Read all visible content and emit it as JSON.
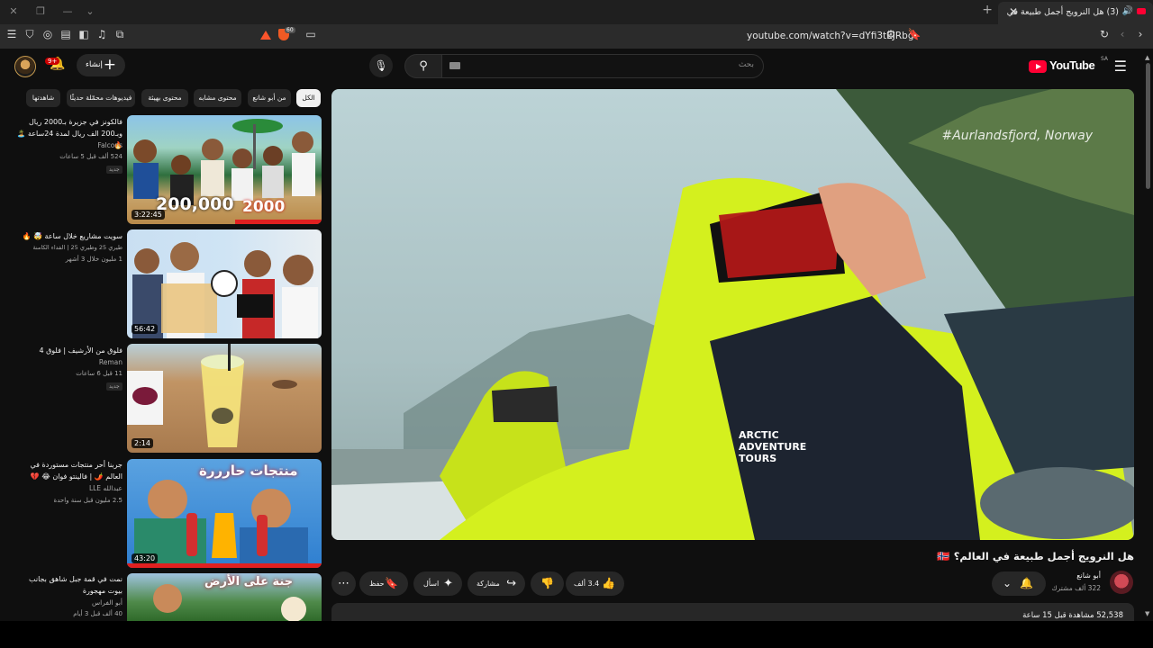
{
  "browser": {
    "tab_title": "(3) هل النرويج أجمل طبيعة في",
    "url": "youtube.com/watch?v=dYfi3tEJRbg",
    "shield_count": "60"
  },
  "header": {
    "logo_text": "YouTube",
    "logo_region": "SA",
    "search_placeholder": "بحث",
    "create_label": "إنشاء",
    "notifications": "9+"
  },
  "chips": [
    "الكل",
    "من أبو شانع",
    "محتوى مشابه",
    "محتوى بهيئة",
    "فيديوهات محمّلة حديثًا",
    "شاهدتها"
  ],
  "related": [
    {
      "title": "فالكونز في جزيرة بـ2000 ريال وبـ200 الف ريال لمدة 24ساعة 🏝️ 🔥",
      "channel": "Falcons",
      "meta": "524 ألف  قبل 5 ساعات",
      "badge": "جديد",
      "duration": "3:22:45",
      "overlay_left": "200,000",
      "overlay_right": "2000"
    },
    {
      "title": "سويت مشاريع خلال ساعة 🤯 🔥",
      "channel": "طيري 25 وطيري 25 | الفداء الكامنة",
      "meta": "1 مليون  خلال 3 أشهر",
      "badge": "",
      "duration": "56:42"
    },
    {
      "title": "فلوق من الأرشيف | فلوق 4",
      "channel": "Reman",
      "meta": "11  قبل 6 ساعات",
      "badge": "جديد",
      "duration": "2:14"
    },
    {
      "title": "جربنا أحر منتجات مستوردة في العالم 🌶️ | فالينتو فوان 😂 💔",
      "channel": "عبدالله LLE",
      "meta": "2.5 مليون  قبل سنة واحدة",
      "badge": "",
      "duration": "43:20",
      "overlay_text": "منتجات حارررة"
    },
    {
      "title": "نمت في قمة جبل شاهق بجانب بيوت مهجورة",
      "channel": "أبو الفراس",
      "meta": "40 ألف  قبل 3 أيام",
      "badge": "",
      "duration": "",
      "overlay_text": "جنة على الأرض"
    }
  ],
  "video": {
    "hashtag": "#Aurlandsfjord, Norway",
    "jacket_text": "ARCTIC ADVENTURE TOURS",
    "title": "هل النرويج أجمل طبيعة في العالم؟ 🇳🇴",
    "channel_name": "أبو شانع",
    "subscribers": "322 ألف مشترك",
    "likes": "3.4 ألف",
    "share_label": "مشاركة",
    "ask_label": "اسأل",
    "save_label": "حفظ",
    "description": "52,538 مشاهدة  قبل 15 ساعة"
  },
  "colors": {
    "background": "#0f0f0f",
    "surface": "#272727",
    "brand_red": "#ff0033",
    "jacket_neon": "#d4f01e"
  },
  "icons": [
    "menu-icon",
    "search-icon",
    "mic-icon",
    "plus-icon",
    "bell-icon",
    "like-icon",
    "dislike-icon",
    "share-icon",
    "sparkle-icon",
    "bookmark-icon",
    "more-icon"
  ]
}
